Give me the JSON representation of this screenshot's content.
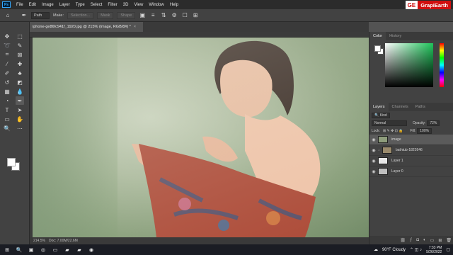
{
  "menubar": {
    "logo": "Ps",
    "items": [
      "File",
      "Edit",
      "Image",
      "Layer",
      "Type",
      "Select",
      "Filter",
      "3D",
      "View",
      "Window",
      "Help"
    ],
    "brand_prefix": "GE",
    "brand_name": "GrapiEarth"
  },
  "options": {
    "tool_icon": "pen-icon",
    "mode": "Path",
    "make_label": "Make:",
    "selection_btn": "Selection...",
    "mask_btn": "Mask",
    "shape_btn": "Shape"
  },
  "document": {
    "tab_title": "iphone-ge86fc941f_1920.jpg @ 215% (image, RGB/8#) *",
    "close": "×"
  },
  "status": {
    "zoom": "214.5%",
    "doc": "Doc: 7.00M/22.6M"
  },
  "color_panel": {
    "tabs": [
      "Color",
      "History"
    ],
    "accent_color": "#1ec45a"
  },
  "layers_panel": {
    "tabs": [
      "Layers",
      "Channels",
      "Paths"
    ],
    "kind_label": "Kind",
    "blend_mode": "Normal",
    "opacity_label": "Opacity:",
    "opacity_value": "72%",
    "lock_label": "Lock:",
    "fill_label": "Fill:",
    "fill_value": "100%",
    "layers": [
      {
        "name": "image",
        "selected": true
      },
      {
        "name": "bathtub-1822646",
        "selected": false
      },
      {
        "name": "Layer 1",
        "selected": false
      },
      {
        "name": "Layer 0",
        "selected": false
      }
    ]
  },
  "taskbar": {
    "weather": "90°F  Cloudy",
    "time": "7:33 PM",
    "date": "5/26/2022"
  }
}
